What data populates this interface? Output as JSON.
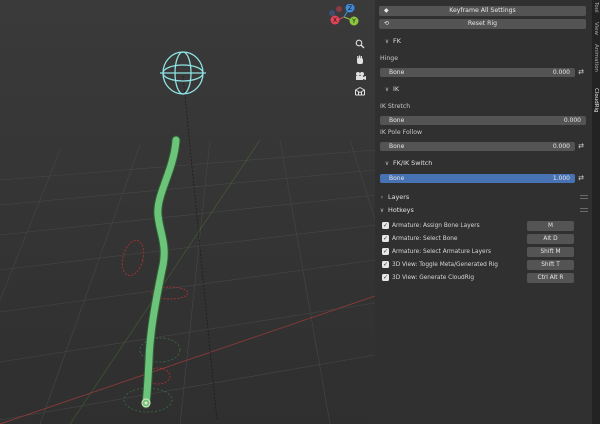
{
  "viewport": {
    "gizmo": {
      "x_axis": "X",
      "y_axis": "Y",
      "z_axis": "Z",
      "x_color": "#e2445a",
      "y_color": "#8cc63f",
      "z_color": "#3f8bd8"
    },
    "tools": [
      "zoom-icon",
      "hand-icon",
      "camera-icon",
      "grid-icon"
    ],
    "bone_color": "#6cc37a",
    "widget_color": "#8fe3e3",
    "ik_ring_color": "#a93232"
  },
  "panel": {
    "keyframe_all_label": "Keyframe All Settings",
    "reset_rig_label": "Reset Rig",
    "fk": {
      "header": "FK",
      "hinge_label": "Hinge",
      "hinge_field_name": "Bone",
      "hinge_value": "0.000"
    },
    "ik": {
      "header": "IK",
      "stretch_label": "IK Stretch",
      "stretch_field_name": "Bone",
      "stretch_value": "0.000",
      "pole_label": "IK Pole Follow",
      "pole_field_name": "Bone",
      "pole_value": "0.000"
    },
    "fkik": {
      "header": "FK/IK Switch",
      "field_name": "Bone",
      "value": "1.000"
    },
    "layers": {
      "header": "Layers"
    },
    "hotkeys": {
      "header": "Hotkeys",
      "items": [
        {
          "label": "Armature: Assign Bone Layers",
          "key": "M",
          "checked": true
        },
        {
          "label": "Armature: Select Bone",
          "key": "Alt D",
          "checked": true
        },
        {
          "label": "Armature: Select Armature Layers",
          "key": "Shift M",
          "checked": true
        },
        {
          "label": "3D View: Toggle Meta/Generated Rig",
          "key": "Shift T",
          "checked": true
        },
        {
          "label": "3D View: Generate CloudRig",
          "key": "Ctrl Alt R",
          "checked": true
        }
      ]
    }
  },
  "tabs": [
    "Tool",
    "View",
    "Animation",
    "CloudRig"
  ]
}
